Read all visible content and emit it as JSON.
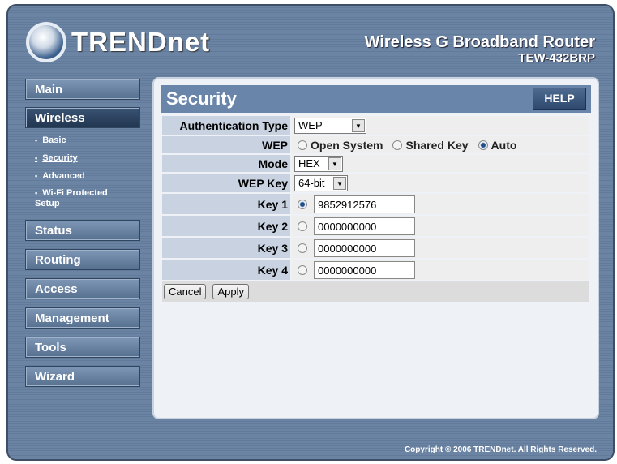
{
  "brand": {
    "logo": "TRENDnet",
    "product": "Wireless G Broadband Router",
    "model": "TEW-432BRP"
  },
  "sidebar": {
    "items": [
      "Main",
      "Wireless",
      "Status",
      "Routing",
      "Access",
      "Management",
      "Tools",
      "Wizard"
    ],
    "wireless_sub": [
      "Basic",
      "Security",
      "Advanced",
      "Wi-Fi Protected Setup"
    ]
  },
  "page": {
    "title": "Security",
    "help": "HELP",
    "auth_label": "Authentication Type",
    "auth_value": "WEP",
    "wep_label": "WEP",
    "wep_options": [
      "Open System",
      "Shared Key",
      "Auto"
    ],
    "wep_selected": "Auto",
    "mode_label": "Mode",
    "mode_value": "HEX",
    "wepkey_label": "WEP Key",
    "wepkey_value": "64-bit",
    "keys": [
      {
        "label": "Key 1",
        "value": "9852912576"
      },
      {
        "label": "Key 2",
        "value": "0000000000"
      },
      {
        "label": "Key 3",
        "value": "0000000000"
      },
      {
        "label": "Key 4",
        "value": "0000000000"
      }
    ],
    "selected_key": "Key 1",
    "cancel": "Cancel",
    "apply": "Apply"
  },
  "footer": "Copyright © 2006 TRENDnet. All Rights Reserved."
}
